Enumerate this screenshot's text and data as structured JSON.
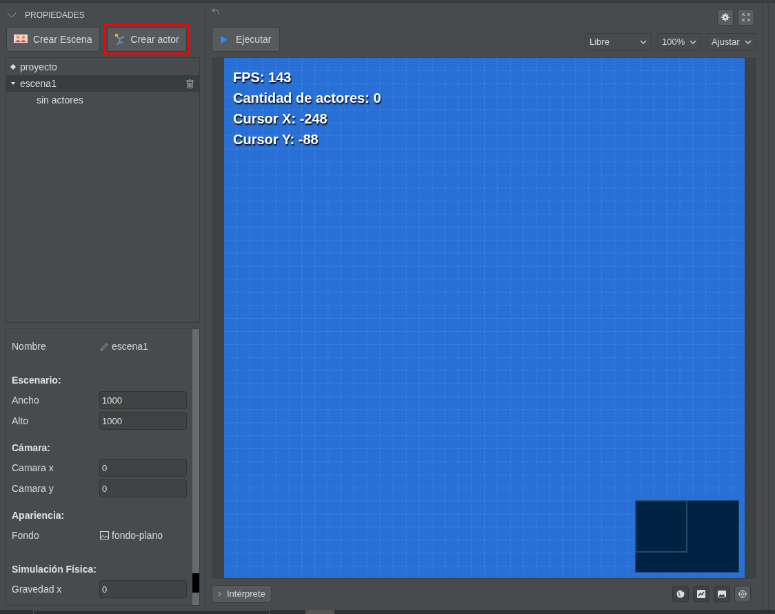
{
  "panel": {
    "title": "PROPIEDADES"
  },
  "create_buttons": [
    {
      "label": "Crear Escena",
      "kind": "scene",
      "highlighted": false
    },
    {
      "label": "Crear actor",
      "kind": "actor",
      "highlighted": true
    }
  ],
  "tree": [
    {
      "label": "proyecto",
      "kind": "project",
      "selected": false
    },
    {
      "label": "escena1",
      "kind": "scene",
      "selected": true,
      "expanded": true,
      "children": [
        {
          "label": "sin actores",
          "selected": false
        }
      ]
    }
  ],
  "properties": [
    {
      "kind": "name",
      "label": "Nombre",
      "value": "escena1"
    },
    {
      "kind": "heading",
      "label": "Escenario:"
    },
    {
      "kind": "input",
      "label": "Ancho",
      "value": "1000"
    },
    {
      "kind": "input",
      "label": "Alto",
      "value": "1000"
    },
    {
      "kind": "heading",
      "label": "Cámara:"
    },
    {
      "kind": "input",
      "label": "Camara x",
      "value": "0"
    },
    {
      "kind": "input",
      "label": "Camara y",
      "value": "0"
    },
    {
      "kind": "heading",
      "label": "Apariencia:"
    },
    {
      "kind": "image",
      "label": "Fondo",
      "value": "fondo-plano"
    },
    {
      "kind": "heading",
      "label": "Simulación Física:"
    },
    {
      "kind": "input",
      "label": "Gravedad x",
      "value": "0"
    }
  ],
  "toolbar": {
    "run_button": "Ejecutar",
    "mode": "Libre",
    "zoom": "100%",
    "fit": "Ajustar"
  },
  "canvas": {
    "overlay": [
      "FPS: 143",
      "Cantidad de actores: 0",
      "Cursor X: -248",
      "Cursor Y: -88"
    ]
  },
  "bottom": {
    "console_button": "Intérprete"
  }
}
